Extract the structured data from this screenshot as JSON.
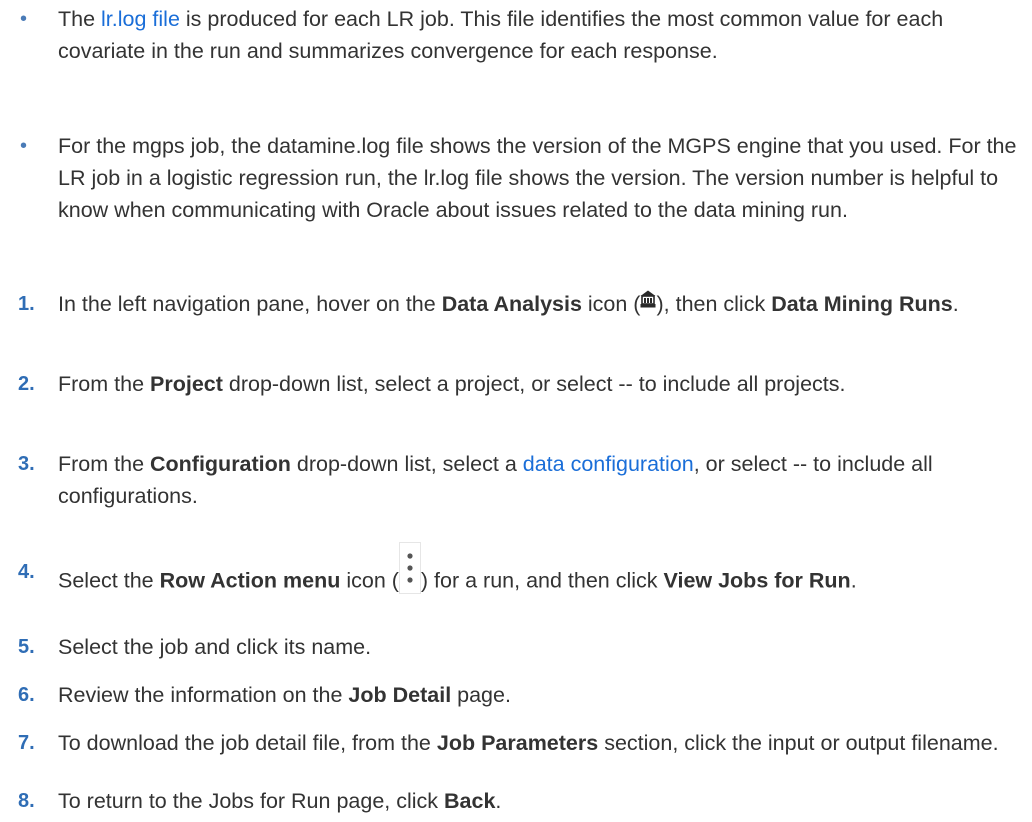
{
  "bullets": [
    {
      "marker": "•",
      "b1_pre": "The ",
      "b1_link": "lr.log file",
      "b1_post": " is produced for each LR job. This file identifies the most common value for each covariate in the run and summarizes convergence for each response."
    },
    {
      "marker": "•",
      "text": "For the mgps job, the datamine.log file shows the version of the MGPS engine that you used. For the LR job in a logistic regression run, the lr.log file shows the version. The version number is helpful to know when communicating with Oracle about issues related to the data mining run."
    }
  ],
  "steps": [
    {
      "num": "1.",
      "p1": "In the left navigation pane, hover on the ",
      "b1": "Data Analysis",
      "p2": " icon (",
      "icon": "data-analysis-icon",
      "p3": "), then click ",
      "b2": "Data Mining Runs",
      "p4": "."
    },
    {
      "num": "2.",
      "p1": "From the ",
      "b1": "Project",
      "p2": " drop-down list, select a project, or select -- to include all projects."
    },
    {
      "num": "3.",
      "p1": "From the ",
      "b1": "Configuration",
      "p2": " drop-down list, select a ",
      "link": "data configuration",
      "p3": ", or select -- to include all configurations."
    },
    {
      "num": "4.",
      "p1": "Select the ",
      "b1": "Row Action menu",
      "p2": " icon (",
      "icon": "row-action-menu-icon",
      "p3": ") for a run, and then click ",
      "b2": "View Jobs for Run",
      "p4": "."
    },
    {
      "num": "5.",
      "p1": "Select the job and click its name."
    },
    {
      "num": "6.",
      "p1": "Review the information on the ",
      "b1": "Job Detail",
      "p2": " page."
    },
    {
      "num": "7.",
      "p1": "To download the job detail file, from the ",
      "b1": "Job Parameters",
      "p2": " section, click the input or output filename."
    },
    {
      "num": "8.",
      "p1": "To return to the Jobs for Run page, click ",
      "b1": "Back",
      "p2": "."
    }
  ],
  "colors": {
    "text": "#333333",
    "link": "#1a6ed8",
    "marker": "#2f6db5"
  }
}
